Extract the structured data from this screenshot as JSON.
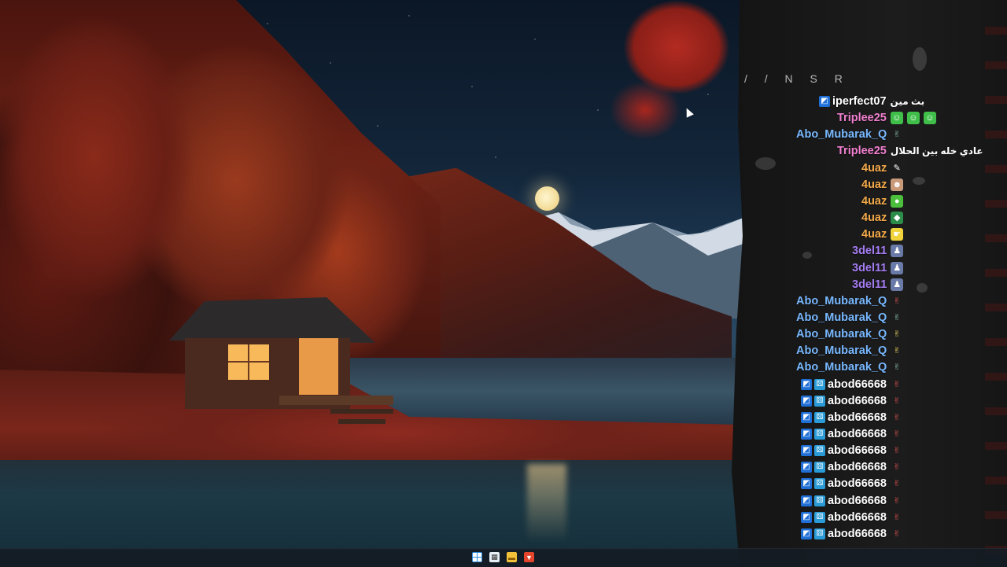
{
  "overlay": {
    "brand": "/ /  N S R"
  },
  "chat": {
    "messages": [
      {
        "user": "iperfect07",
        "color": "#ffffff",
        "text": "بث مين",
        "badges": [
          "prime-icon"
        ],
        "emotes": []
      },
      {
        "user": "Triplee25",
        "color": "#f27fd0",
        "text": "",
        "badges": [],
        "emotes": [
          "frog-smile-icon",
          "frog-smile-icon",
          "frog-smile-icon"
        ]
      },
      {
        "user": "Abo_Mubarak_Q",
        "color": "#78b8ff",
        "text": "",
        "badges": [],
        "emotes": [
          "peace-hand-icon"
        ]
      },
      {
        "user": "Triplee25",
        "color": "#f27fd0",
        "text": "عادي خله بين الحلال",
        "badges": [],
        "emotes": []
      },
      {
        "user": "4uaz",
        "color": "#f2a94a",
        "text": "",
        "badges": [],
        "emotes": [
          "pen-icon"
        ]
      },
      {
        "user": "4uaz",
        "color": "#f2a94a",
        "text": "",
        "badges": [],
        "emotes": [
          "face-icon"
        ]
      },
      {
        "user": "4uaz",
        "color": "#f2a94a",
        "text": "",
        "badges": [],
        "emotes": [
          "frog-icon"
        ]
      },
      {
        "user": "4uaz",
        "color": "#f2a94a",
        "text": "",
        "badges": [],
        "emotes": [
          "frog-car-icon"
        ]
      },
      {
        "user": "4uaz",
        "color": "#f2a94a",
        "text": "",
        "badges": [],
        "emotes": [
          "pointing-icon"
        ]
      },
      {
        "user": "3del11",
        "color": "#a47cf2",
        "text": "",
        "badges": [],
        "emotes": [
          "character-icon"
        ]
      },
      {
        "user": "3del11",
        "color": "#a47cf2",
        "text": "",
        "badges": [],
        "emotes": [
          "character-icon"
        ]
      },
      {
        "user": "3del11",
        "color": "#a47cf2",
        "text": "",
        "badges": [],
        "emotes": [
          "character-icon"
        ]
      },
      {
        "user": "Abo_Mubarak_Q",
        "color": "#78b8ff",
        "text": "",
        "badges": [],
        "emotes": [
          "peace-hand-red-icon"
        ]
      },
      {
        "user": "Abo_Mubarak_Q",
        "color": "#78b8ff",
        "text": "",
        "badges": [],
        "emotes": [
          "peace-hand-icon"
        ]
      },
      {
        "user": "Abo_Mubarak_Q",
        "color": "#78b8ff",
        "text": "",
        "badges": [],
        "emotes": [
          "peace-hand-yellow-icon"
        ]
      },
      {
        "user": "Abo_Mubarak_Q",
        "color": "#78b8ff",
        "text": "",
        "badges": [],
        "emotes": [
          "peace-hand-yellow-icon"
        ]
      },
      {
        "user": "Abo_Mubarak_Q",
        "color": "#78b8ff",
        "text": "",
        "badges": [],
        "emotes": [
          "peace-hand-icon"
        ]
      },
      {
        "user": "abod66668",
        "color": "#ffffff",
        "text": "",
        "badges": [
          "prime-icon",
          "sub-icon"
        ],
        "emotes": [
          "peace-hand-red-icon"
        ]
      },
      {
        "user": "abod66668",
        "color": "#ffffff",
        "text": "",
        "badges": [
          "prime-icon",
          "sub-icon"
        ],
        "emotes": [
          "peace-hand-red-icon"
        ]
      },
      {
        "user": "abod66668",
        "color": "#ffffff",
        "text": "",
        "badges": [
          "prime-icon",
          "sub-icon"
        ],
        "emotes": [
          "peace-hand-red-icon"
        ]
      },
      {
        "user": "abod66668",
        "color": "#ffffff",
        "text": "",
        "badges": [
          "prime-icon",
          "sub-icon"
        ],
        "emotes": [
          "peace-hand-red-icon"
        ]
      },
      {
        "user": "abod66668",
        "color": "#ffffff",
        "text": "",
        "badges": [
          "prime-icon",
          "sub-icon"
        ],
        "emotes": [
          "peace-hand-red-icon"
        ]
      },
      {
        "user": "abod66668",
        "color": "#ffffff",
        "text": "",
        "badges": [
          "prime-icon",
          "sub-icon"
        ],
        "emotes": [
          "peace-hand-red-icon"
        ]
      },
      {
        "user": "abod66668",
        "color": "#ffffff",
        "text": "",
        "badges": [
          "prime-icon",
          "sub-icon"
        ],
        "emotes": [
          "peace-hand-red-icon"
        ]
      },
      {
        "user": "abod66668",
        "color": "#ffffff",
        "text": "",
        "badges": [
          "prime-icon",
          "sub-icon"
        ],
        "emotes": [
          "peace-hand-red-icon"
        ]
      },
      {
        "user": "abod66668",
        "color": "#ffffff",
        "text": "",
        "badges": [
          "prime-icon",
          "sub-icon"
        ],
        "emotes": [
          "peace-hand-red-icon"
        ]
      },
      {
        "user": "abod66668",
        "color": "#ffffff",
        "text": "",
        "badges": [
          "prime-icon",
          "sub-icon"
        ],
        "emotes": [
          "peace-hand-red-icon"
        ]
      }
    ]
  },
  "taskbar": {
    "icons": [
      "windows-start-icon",
      "calendar-app-icon",
      "file-explorer-icon",
      "brave-browser-icon"
    ]
  },
  "colors": {
    "badge_prime": "#1f6fd6",
    "badge_sub": "#2a9bd6",
    "accent_red": "#c2403a"
  }
}
